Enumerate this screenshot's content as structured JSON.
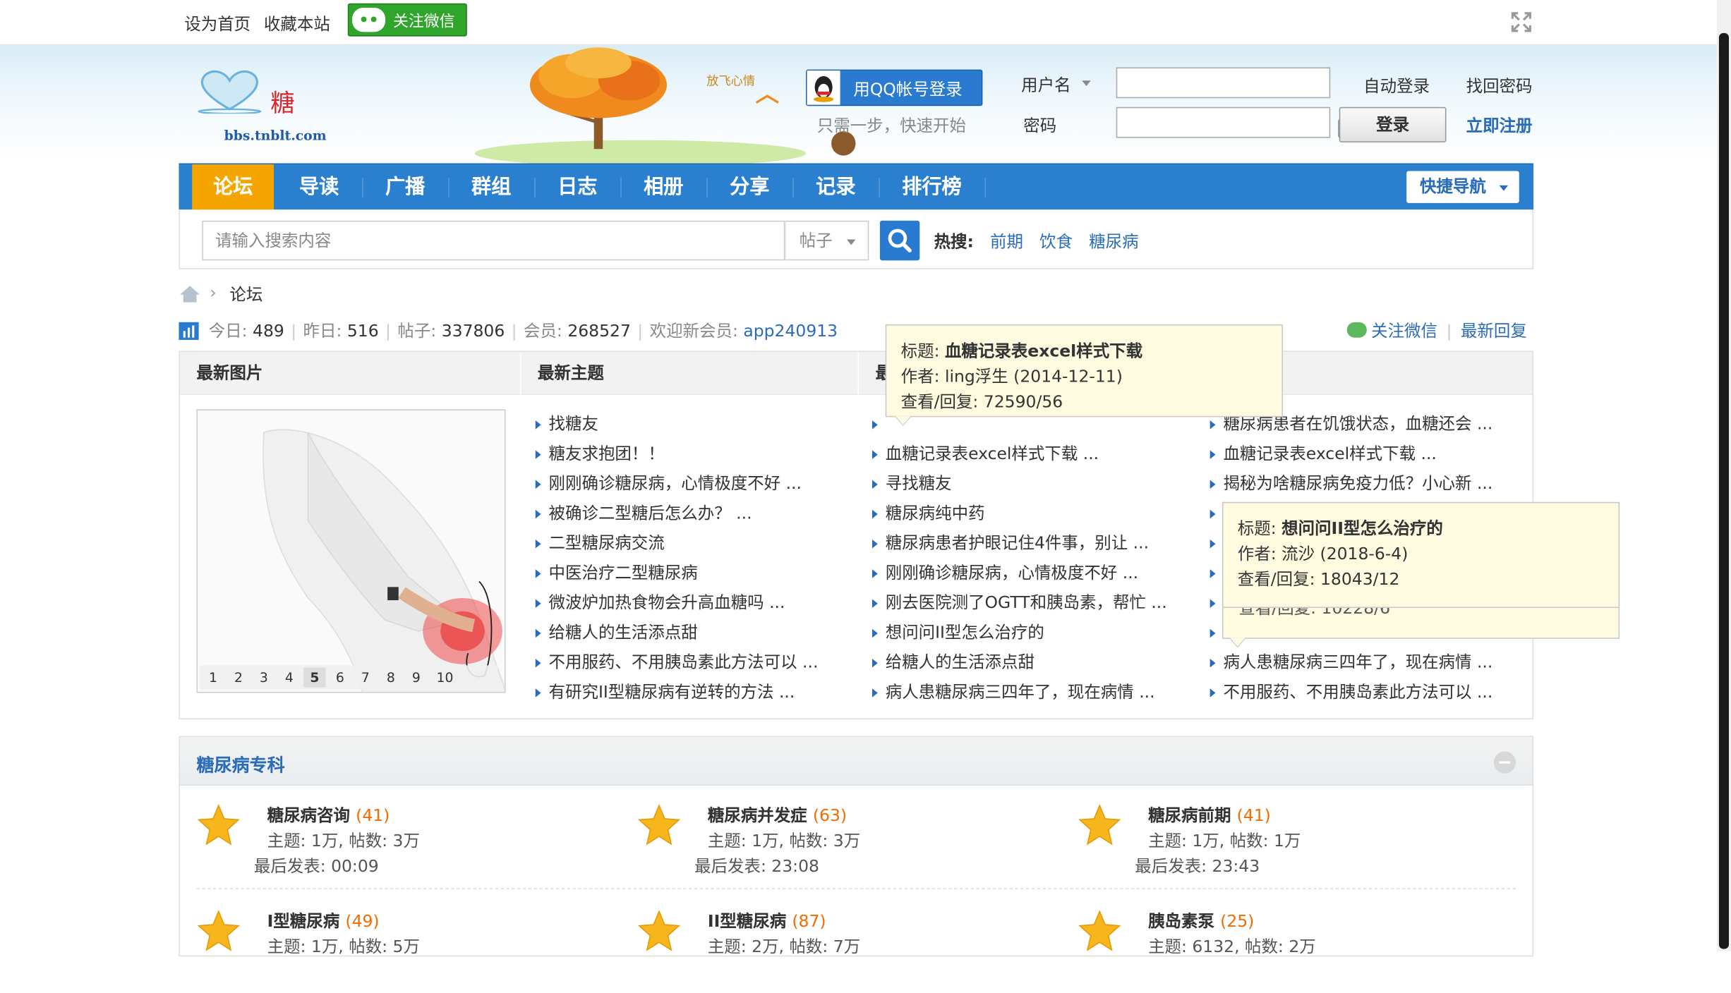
{
  "topbar": {
    "set_home": "设为首页",
    "bookmark": "收藏本站",
    "follow_wechat": "关注微信"
  },
  "header": {
    "logo_char": "糖",
    "logo_url": "bbs.tnblt.com",
    "slogan": "放飞心情",
    "qq_login": "用QQ帐号登录",
    "qq_tip": "只需一步，快速开始",
    "username_label": "用户名",
    "password_label": "密码",
    "auto_login": "自动登录",
    "find_password": "找回密码",
    "login_button": "登录",
    "register": "立即注册"
  },
  "nav": {
    "items": [
      "论坛",
      "导读",
      "广播",
      "群组",
      "日志",
      "相册",
      "分享",
      "记录",
      "排行榜"
    ],
    "quick_nav": "快捷导航"
  },
  "search": {
    "placeholder": "请输入搜索内容",
    "type": "帖子",
    "hot_label": "热搜:",
    "hot_words": [
      "前期",
      "饮食",
      "糖尿病"
    ]
  },
  "breadcrumb": {
    "current": "论坛"
  },
  "stats": {
    "today_label": "今日:",
    "today": "489",
    "yesterday_label": "昨日:",
    "yesterday": "516",
    "posts_label": "帖子:",
    "posts": "337806",
    "members_label": "会员:",
    "members": "268527",
    "welcome_label": "欢迎新会员:",
    "new_member": "app240913",
    "follow_wechat": "关注微信",
    "latest_reply": "最新回复"
  },
  "portal": {
    "headers": [
      "最新图片",
      "最新主题",
      "最"
    ],
    "slide_numbers": [
      "1",
      "2",
      "3",
      "4",
      "5",
      "6",
      "7",
      "8",
      "9",
      "10"
    ],
    "col1": [
      "找糖友",
      "糖友求抱团！！",
      "刚刚确诊糖尿病，心情极度不好 ...",
      "被确诊二型糖后怎么办？ ...",
      "二型糖尿病交流",
      "中医治疗二型糖尿病",
      "微波炉加热食物会升高血糖吗 ...",
      "给糖人的生活添点甜",
      "不用服药、不用胰岛素此方法可以 ...",
      "有研究II型糖尿病有逆转的方法 ..."
    ],
    "col2": [
      "",
      "血糖记录表excel样式下载 ...",
      "寻找糖友",
      "糖尿病纯中药",
      "糖尿病患者护眼记住4件事，别让 ...",
      "刚刚确诊糖尿病，心情极度不好 ...",
      "刚去医院测了OGTT和胰岛素，帮忙 ...",
      "想问问II型怎么治疗的",
      "给糖人的生活添点甜",
      "病人患糖尿病三四年了，现在病情 ..."
    ],
    "col3": [
      "糖尿病患者在饥饿状态，血糖还会 ...",
      "血糖记录表excel样式下载 ...",
      "揭秘为啥糖尿病免疫力低？小心新 ...",
      "",
      "",
      "",
      "",
      "",
      "病人患糖尿病三四年了，现在病情 ...",
      "不用服药、不用胰岛素此方法可以 ..."
    ]
  },
  "tooltip1": {
    "title_label": "标题:",
    "title": "血糖记录表excel样式下载",
    "author_label": "作者:",
    "author": "ling浮生 (2014-12-11)",
    "views_label": "查看/回复:",
    "views": "72590/56"
  },
  "tooltip2": {
    "title_label": "标题:",
    "title": "想问问II型怎么治疗的",
    "author_label": "作者:",
    "author": "流沙 (2018-6-4)",
    "views_label": "查看/回复:",
    "views": "18043/12",
    "hidden_views": "查看/回复: 10228/6"
  },
  "category": {
    "title": "糖尿病专科",
    "forums": [
      {
        "name": "糖尿病咨询",
        "count": "(41)",
        "meta": "主题: 1万, 帖数: 3万",
        "last": "最后发表: 00:09"
      },
      {
        "name": "糖尿病并发症",
        "count": "(63)",
        "meta": "主题: 1万, 帖数: 3万",
        "last": "最后发表: 23:08"
      },
      {
        "name": "糖尿病前期",
        "count": "(41)",
        "meta": "主题: 1万, 帖数: 1万",
        "last": "最后发表: 23:43"
      },
      {
        "name": "I型糖尿病",
        "count": "(49)",
        "meta": "主题: 1万, 帖数: 5万",
        "last": ""
      },
      {
        "name": "II型糖尿病",
        "count": "(87)",
        "meta": "主题: 2万, 帖数: 7万",
        "last": ""
      },
      {
        "name": "胰岛素泵",
        "count": "(25)",
        "meta": "主题: 6132, 帖数: 2万",
        "last": ""
      }
    ]
  }
}
